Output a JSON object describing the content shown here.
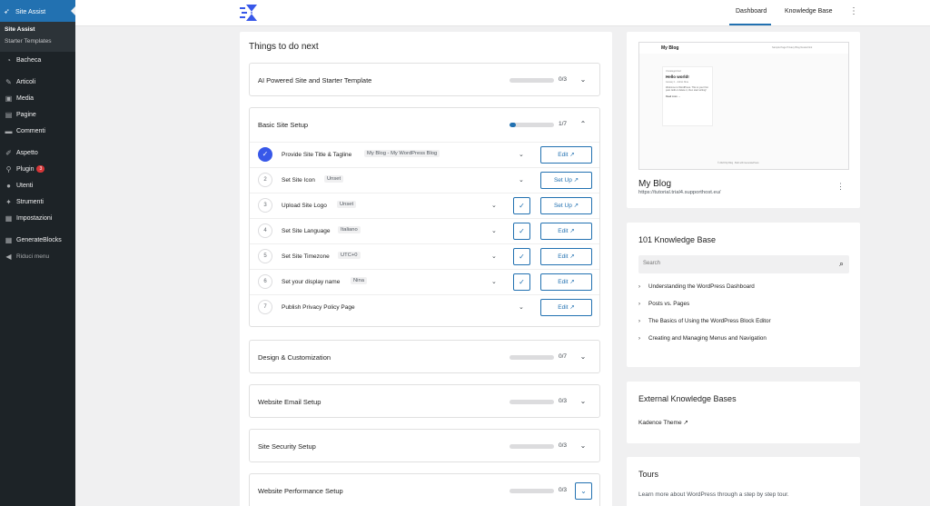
{
  "sidebar": {
    "top_label": "Site Assist",
    "submenu": [
      "Site Assist",
      "Starter Templates"
    ],
    "items": [
      {
        "label": "Bacheca",
        "icon": "dashboard-icon"
      },
      {
        "label": "Articoli",
        "icon": "pin-icon"
      },
      {
        "label": "Media",
        "icon": "media-icon"
      },
      {
        "label": "Pagine",
        "icon": "page-icon"
      },
      {
        "label": "Commenti",
        "icon": "comment-icon"
      },
      {
        "label": "Aspetto",
        "icon": "brush-icon"
      },
      {
        "label": "Plugin",
        "icon": "plugin-icon",
        "badge": "3"
      },
      {
        "label": "Utenti",
        "icon": "users-icon"
      },
      {
        "label": "Strumenti",
        "icon": "wrench-icon"
      },
      {
        "label": "Impostazioni",
        "icon": "settings-icon"
      },
      {
        "label": "GenerateBlocks",
        "icon": "blocks-icon"
      },
      {
        "label": "Riduci menu",
        "icon": "collapse-icon"
      }
    ]
  },
  "topbar": {
    "tab_dashboard": "Dashboard",
    "tab_kb": "Knowledge Base"
  },
  "main": {
    "title": "Things to do next",
    "sections": [
      {
        "title": "AI Powered Site and Starter Template",
        "progress": "0/3",
        "fraction": 0
      },
      {
        "title": "Basic Site Setup",
        "progress": "1/7",
        "fraction": 0.143
      },
      {
        "title": "Design & Customization",
        "progress": "0/7",
        "fraction": 0
      },
      {
        "title": "Website Email Setup",
        "progress": "0/3",
        "fraction": 0
      },
      {
        "title": "Site Security Setup",
        "progress": "0/3",
        "fraction": 0
      },
      {
        "title": "Website Performance Setup",
        "progress": "0/3",
        "fraction": 0
      }
    ],
    "tasks": [
      {
        "num": "✓",
        "label": "Provide Site Title & Tagline",
        "value": "My Blog - My WordPress Blog",
        "button": "Edit ↗"
      },
      {
        "num": "2",
        "label": "Set Site Icon",
        "value": "Unset",
        "button": "Set Up ↗"
      },
      {
        "num": "3",
        "label": "Upload Site Logo",
        "value": "Unset",
        "button": "Set Up ↗"
      },
      {
        "num": "4",
        "label": "Set Site Language",
        "value": "Italiano",
        "button": "Edit ↗"
      },
      {
        "num": "5",
        "label": "Set Site Timezone",
        "value": "UTC+0",
        "button": "Edit ↗"
      },
      {
        "num": "6",
        "label": "Set your display name",
        "value": "Nina",
        "button": "Edit ↗"
      },
      {
        "num": "7",
        "label": "Publish Privacy Policy Page",
        "value": "",
        "button": "Edit ↗"
      }
    ]
  },
  "site": {
    "name": "My Blog",
    "url": "https://tutorial.trial4.supporthost.eu/",
    "preview": {
      "site_title": "My Blog",
      "nav": "Sample Page  Privacy  Blog  Nested link",
      "meta": "Uncategorized",
      "post_title": "Hello world!",
      "date": "January 1 · Admin Nina",
      "excerpt": "Welcome to WordPress. This is your first post. Edit or delete it, then start writing!",
      "read_more": "Read more →",
      "footer": "© 2024 My Blog · Built with GeneratePress"
    }
  },
  "kb": {
    "title": "101 Knowledge Base",
    "search_placeholder": "Search",
    "links": [
      "Understanding the WordPress Dashboard",
      "Posts vs. Pages",
      "The Basics of Using the WordPress Block Editor",
      "Creating and Managing Menus and Navigation"
    ]
  },
  "external": {
    "title": "External Knowledge Bases",
    "link": "Kadence Theme"
  },
  "tours": {
    "title": "Tours",
    "text": "Learn more about WordPress through a step by step tour."
  }
}
